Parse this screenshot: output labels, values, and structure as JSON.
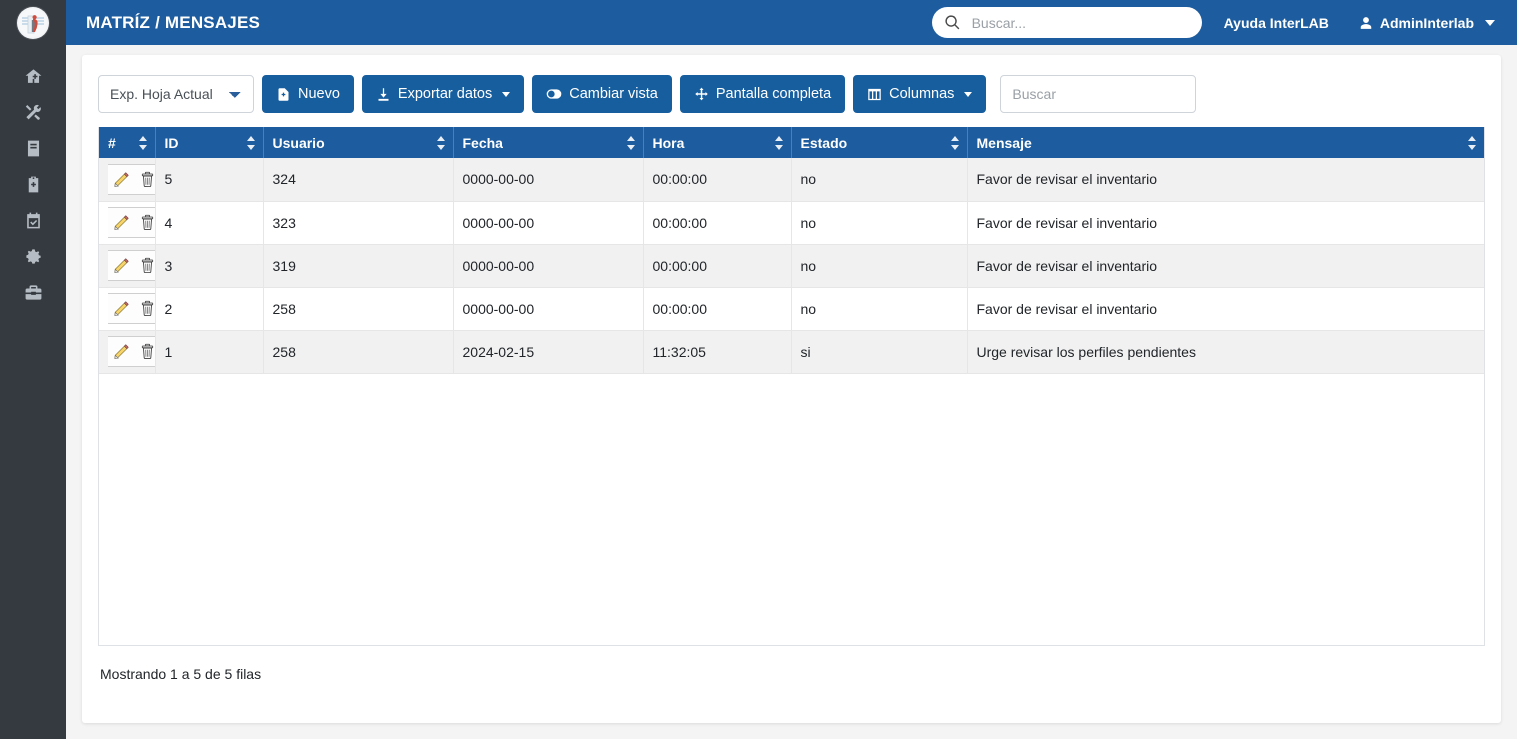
{
  "app": {
    "brand_icon": "lab-logo-icon",
    "title": "MATRÍZ / MENSAJES",
    "accent_blue": "#1d5c9e",
    "button_blue": "#175e9e",
    "sidebar_bg": "#343a40"
  },
  "header": {
    "search_placeholder": "Buscar...",
    "search_value": "",
    "help_label": "Ayuda InterLAB",
    "user_label": "AdminInterlab"
  },
  "sidebar": {
    "items": [
      {
        "name": "home",
        "icon": "home-plus-icon"
      },
      {
        "name": "tools",
        "icon": "tools-icon"
      },
      {
        "name": "records",
        "icon": "book-icon"
      },
      {
        "name": "clipboard",
        "icon": "clipboard-plus-icon"
      },
      {
        "name": "calendar",
        "icon": "calendar-check-icon"
      },
      {
        "name": "settings",
        "icon": "gear-icon"
      },
      {
        "name": "toolbox",
        "icon": "toolbox-icon"
      }
    ]
  },
  "toolbar": {
    "sheet_select": {
      "selected": "Exp. Hoja Actual",
      "options": [
        "Exp. Hoja Actual"
      ]
    },
    "new_label": "Nuevo",
    "new_icon": "file-add-icon",
    "export_label": "Exportar datos",
    "export_icon": "download-icon",
    "view_label": "Cambiar vista",
    "view_icon": "toggle-icon",
    "fullscreen_label": "Pantalla completa",
    "fullscreen_icon": "arrows-expand-icon",
    "columns_label": "Columnas",
    "columns_icon": "table-columns-icon",
    "search_placeholder": "Buscar",
    "search_value": ""
  },
  "table": {
    "columns": [
      {
        "key": "actions",
        "label": ""
      },
      {
        "key": "num",
        "label": "#"
      },
      {
        "key": "id",
        "label": "ID"
      },
      {
        "key": "usuario",
        "label": "Usuario"
      },
      {
        "key": "fecha",
        "label": "Fecha"
      },
      {
        "key": "hora",
        "label": "Hora"
      },
      {
        "key": "estado",
        "label": "Estado"
      },
      {
        "key": "mensaje",
        "label": "Mensaje"
      }
    ],
    "row_actions": {
      "edit_icon": "pencil-icon",
      "delete_icon": "trash-icon"
    },
    "rows": [
      {
        "num": "5",
        "id": "324",
        "usuario": "0000-00-00",
        "fecha": "00:00:00",
        "hora": "no",
        "estado": "Favor de revisar el inventario",
        "mensaje": ""
      },
      {
        "num": "4",
        "id": "323",
        "usuario": "0000-00-00",
        "fecha": "00:00:00",
        "hora": "no",
        "estado": "Favor de revisar el inventario",
        "mensaje": ""
      },
      {
        "num": "3",
        "id": "319",
        "usuario": "0000-00-00",
        "fecha": "00:00:00",
        "hora": "no",
        "estado": "Favor de revisar el inventario",
        "mensaje": ""
      },
      {
        "num": "2",
        "id": "258",
        "usuario": "0000-00-00",
        "fecha": "00:00:00",
        "hora": "no",
        "estado": "Favor de revisar el inventario",
        "mensaje": ""
      },
      {
        "num": "1",
        "id": "258",
        "usuario": "2024-02-15",
        "fecha": "11:32:05",
        "hora": "si",
        "estado": "Urge revisar los perfiles pendientes",
        "mensaje": ""
      }
    ],
    "display_rows": [
      {
        "num": "5",
        "id": "324",
        "usuario": "",
        "fecha": "0000-00-00",
        "hora": "00:00:00",
        "estado": "no",
        "mensaje": "Favor de revisar el inventario"
      },
      {
        "num": "4",
        "id": "323",
        "usuario": "",
        "fecha": "0000-00-00",
        "hora": "00:00:00",
        "estado": "no",
        "mensaje": "Favor de revisar el inventario"
      },
      {
        "num": "3",
        "id": "319",
        "usuario": "",
        "fecha": "0000-00-00",
        "hora": "00:00:00",
        "estado": "no",
        "mensaje": "Favor de revisar el inventario"
      },
      {
        "num": "2",
        "id": "258",
        "usuario": "",
        "fecha": "0000-00-00",
        "hora": "00:00:00",
        "estado": "no",
        "mensaje": "Favor de revisar el inventario"
      },
      {
        "num": "1",
        "id": "258",
        "usuario": "",
        "fecha": "2024-02-15",
        "hora": "11:32:05",
        "estado": "si",
        "mensaje": "Urge revisar los perfiles pendientes"
      }
    ],
    "footer_text": "Mostrando 1 a 5 de 5 filas"
  }
}
